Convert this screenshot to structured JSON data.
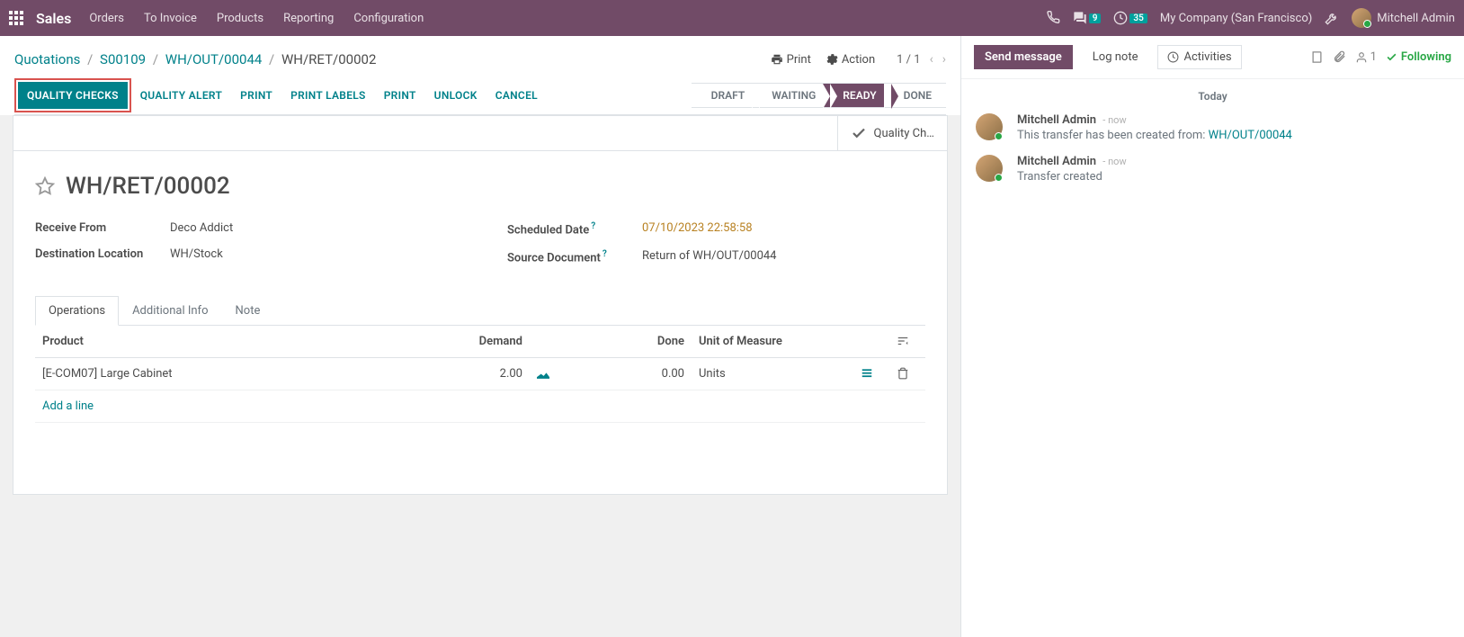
{
  "topbar": {
    "brand": "Sales",
    "menu": [
      "Orders",
      "To Invoice",
      "Products",
      "Reporting",
      "Configuration"
    ],
    "msg_badge": "9",
    "clock_badge": "35",
    "company": "My Company (San Francisco)",
    "user": "Mitchell Admin"
  },
  "breadcrumb": {
    "items": [
      "Quotations",
      "S00109",
      "WH/OUT/00044"
    ],
    "current": "WH/RET/00002"
  },
  "cp": {
    "print": "Print",
    "action": "Action",
    "pager": "1 / 1"
  },
  "toolbar": {
    "quality_checks": "QUALITY CHECKS",
    "quality_alert": "QUALITY ALERT",
    "print": "PRINT",
    "print_labels": "PRINT LABELS",
    "print2": "PRINT",
    "unlock": "UNLOCK",
    "cancel": "CANCEL"
  },
  "status": {
    "draft": "DRAFT",
    "waiting": "WAITING",
    "ready": "READY",
    "done": "DONE"
  },
  "stat": {
    "quality": "Quality Ch…"
  },
  "record": {
    "title": "WH/RET/00002",
    "receive_from_label": "Receive From",
    "receive_from": "Deco Addict",
    "dest_label": "Destination Location",
    "dest": "WH/Stock",
    "sched_label": "Scheduled Date",
    "sched": "07/10/2023 22:58:58",
    "src_label": "Source Document",
    "src": "Return of WH/OUT/00044"
  },
  "tabs": {
    "operations": "Operations",
    "additional": "Additional Info",
    "note": "Note"
  },
  "table": {
    "headers": {
      "product": "Product",
      "demand": "Demand",
      "done": "Done",
      "uom": "Unit of Measure"
    },
    "row": {
      "product": "[E-COM07] Large Cabinet",
      "demand": "2.00",
      "done": "0.00",
      "uom": "Units"
    },
    "add_line": "Add a line"
  },
  "chatter": {
    "send": "Send message",
    "log": "Log note",
    "activities": "Activities",
    "followers": "1",
    "following": "Following",
    "today": "Today",
    "msg1": {
      "author": "Mitchell Admin",
      "time": "now",
      "text": "This transfer has been created from: ",
      "link": "WH/OUT/00044"
    },
    "msg2": {
      "author": "Mitchell Admin",
      "time": "now",
      "text": "Transfer created"
    }
  }
}
